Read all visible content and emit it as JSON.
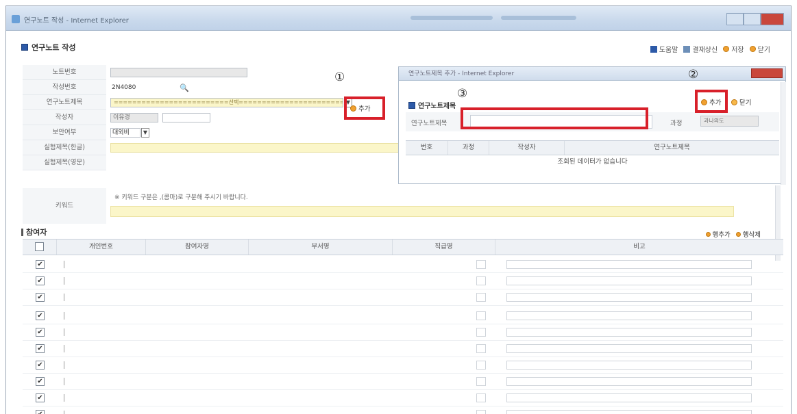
{
  "window": {
    "title": "연구노트 작성 - Internet Explorer"
  },
  "page": {
    "title": "연구노트 작성"
  },
  "toolbar": {
    "items": [
      {
        "label": "도움말",
        "icon": "help-book-icon"
      },
      {
        "label": "결재상신",
        "icon": "approval-icon"
      },
      {
        "label": "저장",
        "icon": "orange-dot-icon"
      },
      {
        "label": "닫기",
        "icon": "orange-dot-icon"
      }
    ]
  },
  "form": {
    "note_no_label": "노트번호",
    "creator_no_label": "작성번호",
    "creator_no_value": "2N4080",
    "research_title_label": "연구노트제목",
    "research_title_value": "=========================선택=========================",
    "author_label": "작성자",
    "author_value": "이유경",
    "security_label": "보안여부",
    "security_value": "대외비",
    "exp_title_kr_label": "실험제목(한글)",
    "exp_title_en_label": "실험제목(영문)",
    "keyword_label": "키워드",
    "keyword_hint": "※ 키워드 구분은 ,(콤마)로 구분해 주시기 바랍니다.",
    "add_button_label": "추가"
  },
  "annotations": {
    "one": "①",
    "two": "②",
    "three": "③"
  },
  "subwindow": {
    "title": "연구노트제목 추가 - Internet Explorer",
    "heading": "연구노트제목",
    "add_label": "추가",
    "close_label": "닫기",
    "search_label": "연구노트제목",
    "dept_label": "과정",
    "dept_value": "과나의도",
    "columns": [
      "번호",
      "과정",
      "작성자",
      "연구노트제목"
    ],
    "empty_message": "조회된 데이터가 없습니다"
  },
  "participants": {
    "title": "참여자",
    "add_row_label": "행추가",
    "delete_row_label": "행삭제",
    "columns": [
      "개인번호",
      "참여자명",
      "부서명",
      "직급명",
      "비고"
    ]
  },
  "colors": {
    "accent": "#2d5aa8",
    "highlight_red": "#d8202a",
    "input_yellow": "#fbf6c9"
  }
}
